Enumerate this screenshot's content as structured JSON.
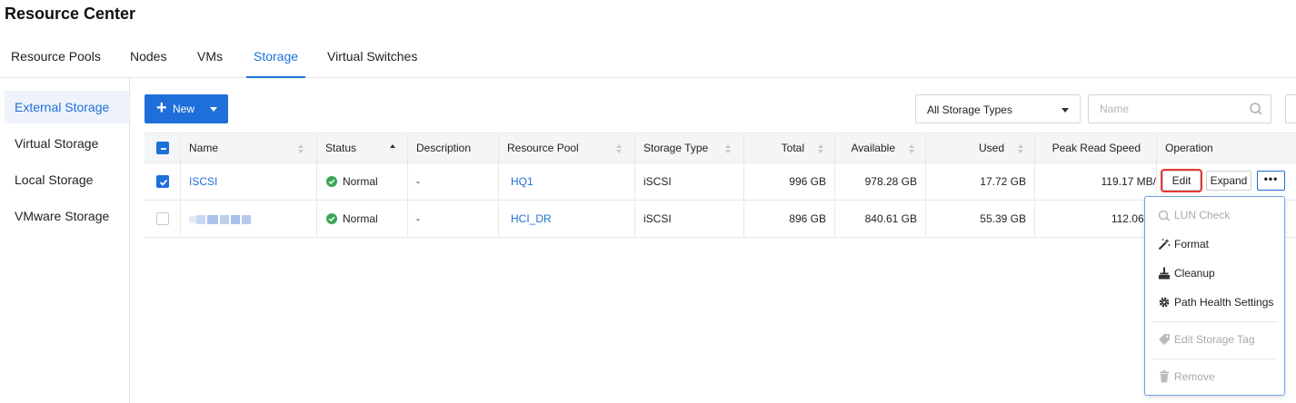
{
  "page": {
    "title": "Resource Center"
  },
  "top_tabs": [
    {
      "label": "Resource Pools",
      "active": false
    },
    {
      "label": "Nodes",
      "active": false
    },
    {
      "label": "VMs",
      "active": false
    },
    {
      "label": "Storage",
      "active": true
    },
    {
      "label": "Virtual Switches",
      "active": false
    }
  ],
  "side_nav": [
    {
      "label": "External Storage",
      "active": true
    },
    {
      "label": "Virtual Storage",
      "active": false
    },
    {
      "label": "Local Storage",
      "active": false
    },
    {
      "label": "VMware Storage",
      "active": false
    }
  ],
  "toolbar": {
    "new_label": "New",
    "type_select_value": "All Storage Types",
    "search_placeholder": "Name"
  },
  "table": {
    "columns": [
      "Name",
      "Status",
      "Description",
      "Resource Pool",
      "Storage Type",
      "Total",
      "Available",
      "Used",
      "Peak Read Speed",
      "Operation"
    ],
    "rows": [
      {
        "checked": true,
        "name": "ISCSI",
        "status": "Normal",
        "description": "-",
        "resource_pool": "HQ1",
        "storage_type": "iSCSI",
        "total": "996 GB",
        "available": "978.28 GB",
        "used": "17.72 GB",
        "peak_read": "119.17 MB/"
      },
      {
        "checked": false,
        "name": "",
        "status": "Normal",
        "description": "-",
        "resource_pool": "HCI_DR",
        "storage_type": "iSCSI",
        "total": "896 GB",
        "available": "840.61 GB",
        "used": "55.39 GB",
        "peak_read": "112.06 M"
      }
    ]
  },
  "operations": {
    "edit": "Edit",
    "expand": "Expand",
    "more": "•••"
  },
  "more_menu": [
    {
      "label": "LUN Check",
      "icon": "lun-check-icon",
      "disabled": true
    },
    {
      "label": "Format",
      "icon": "magic-wand-icon",
      "disabled": false
    },
    {
      "label": "Cleanup",
      "icon": "broom-icon",
      "disabled": false
    },
    {
      "label": "Path Health Settings",
      "icon": "gear-icon",
      "disabled": false
    },
    {
      "label": "Edit Storage Tag",
      "icon": "tag-icon",
      "disabled": true
    },
    {
      "label": "Remove",
      "icon": "trash-icon",
      "disabled": true
    }
  ],
  "colors": {
    "accent": "#1e6fd9",
    "status_ok": "#3aa757",
    "highlight": "#e53935"
  }
}
